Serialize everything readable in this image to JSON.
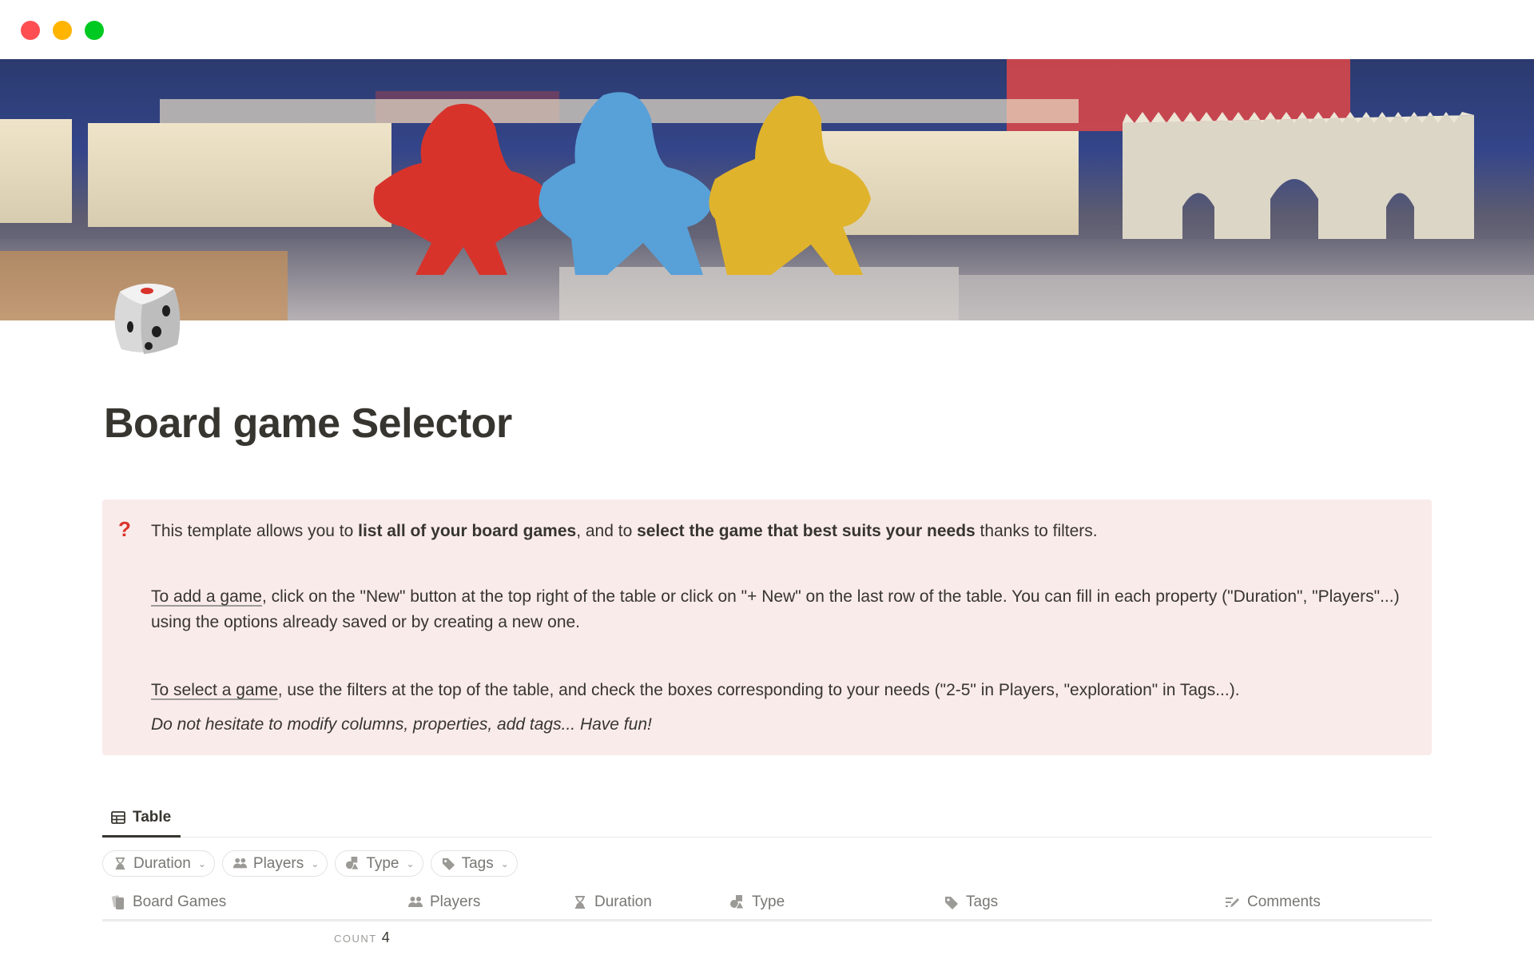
{
  "window": {
    "controls": [
      "close",
      "minimize",
      "maximize"
    ]
  },
  "cover": {
    "description": "Board game meeples (red, blue, yellow) with castle pieces"
  },
  "page": {
    "icon": "game-die-icon",
    "title": "Board game Selector"
  },
  "callout": {
    "icon": "?",
    "icon_color": "#d9342b",
    "background": "#faebeb",
    "p1": {
      "t1": "This template allows you to ",
      "b1": "list all of your board games",
      "t2": ", and to ",
      "b2": "select the game that best suits your needs",
      "t3": " thanks to filters."
    },
    "p2": {
      "u": "To add a game",
      "t": ", click on the \"New\" button at the top right of the table or click on \"+ New\" on the last row of the table. You can fill in each property (\"Duration\", \"Players\"...) using the options already saved or by creating a new one."
    },
    "p3": {
      "u": "To select a game",
      "t": ", use the filters at the top of the table, and check the boxes corresponding to your needs (\"2-5\" in Players, \"exploration\" in Tags...)."
    },
    "p4": "Do not hesitate to modify columns, properties, add tags... Have fun!"
  },
  "views": {
    "tabs": [
      {
        "label": "Table",
        "icon": "table-icon",
        "active": true
      }
    ]
  },
  "filters": [
    {
      "label": "Duration",
      "icon": "hourglass-icon"
    },
    {
      "label": "Players",
      "icon": "people-icon"
    },
    {
      "label": "Type",
      "icon": "shapes-icon"
    },
    {
      "label": "Tags",
      "icon": "tag-icon"
    }
  ],
  "table": {
    "columns": [
      {
        "label": "Board Games",
        "icon": "cards-icon"
      },
      {
        "label": "Players",
        "icon": "people-icon"
      },
      {
        "label": "Duration",
        "icon": "hourglass-icon"
      },
      {
        "label": "Type",
        "icon": "shapes-icon"
      },
      {
        "label": "Tags",
        "icon": "tag-icon"
      },
      {
        "label": "Comments",
        "icon": "text-edit-icon"
      }
    ],
    "count_label": "COUNT",
    "count_value": "4"
  }
}
